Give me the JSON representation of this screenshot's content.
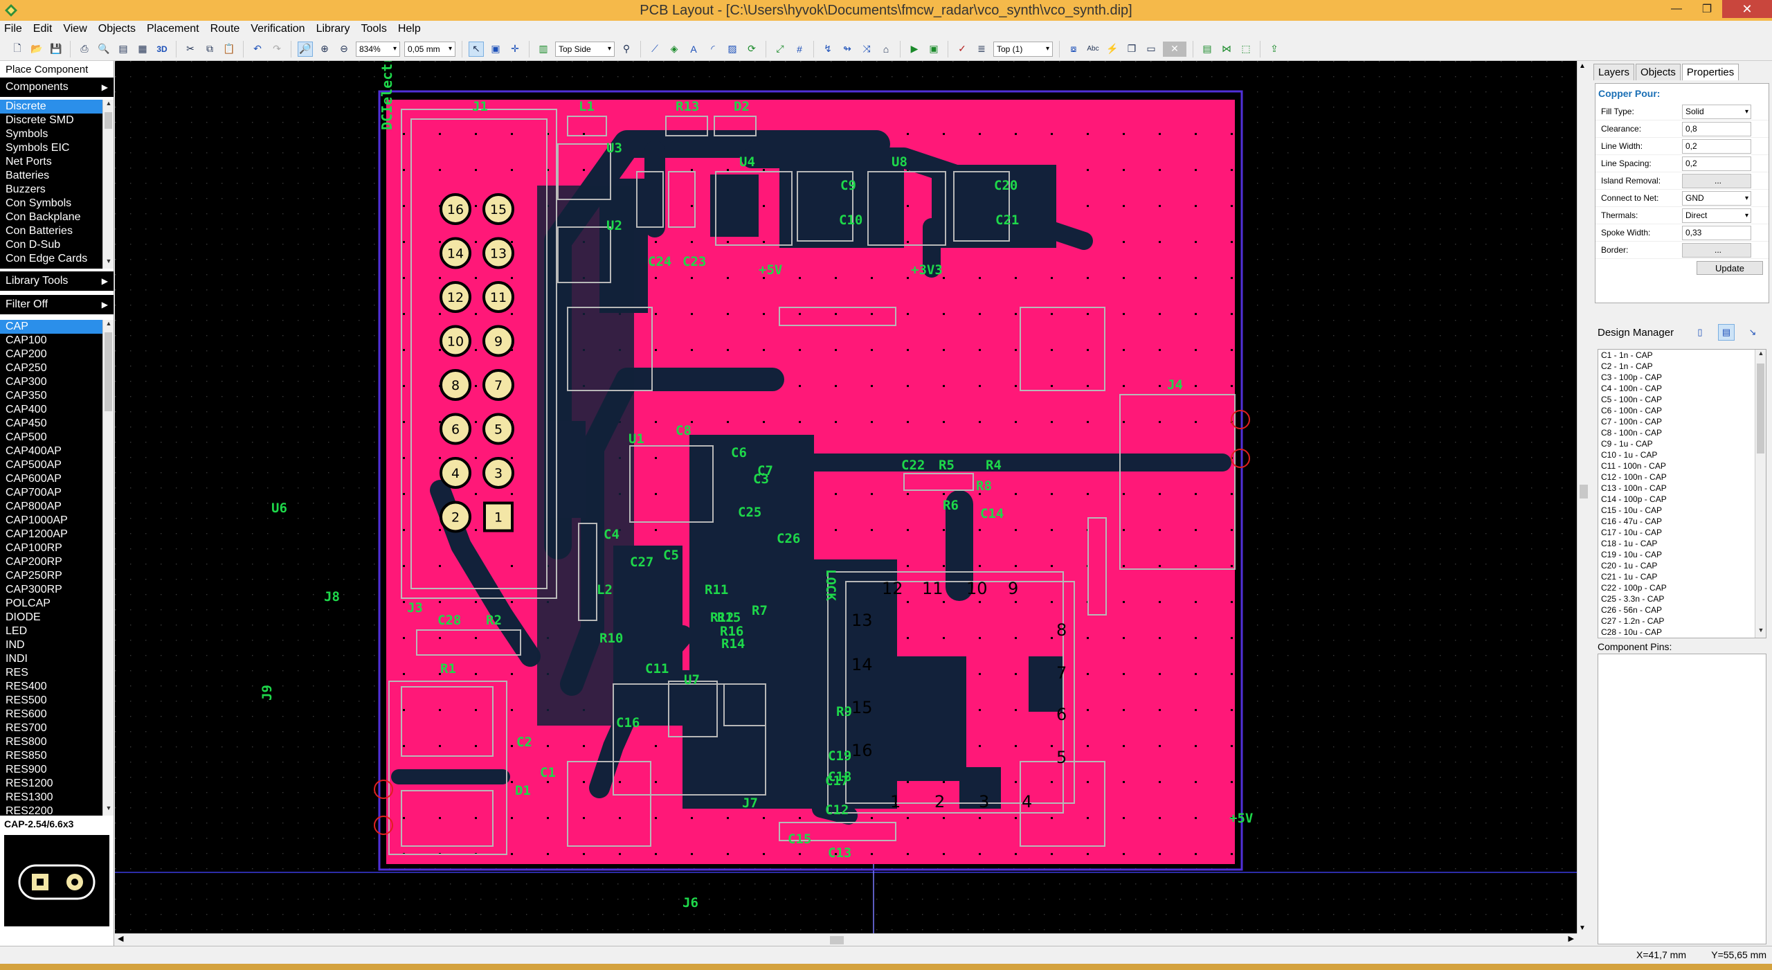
{
  "window": {
    "title": "PCB Layout - [C:\\Users\\hyvok\\Documents\\fmcw_radar\\vco_synth\\vco_synth.dip]"
  },
  "menu": [
    "File",
    "Edit",
    "View",
    "Objects",
    "Placement",
    "Route",
    "Verification",
    "Library",
    "Tools",
    "Help"
  ],
  "toolbar": {
    "zoom": "834%",
    "grid": "0,05 mm",
    "side": "Top Side",
    "layer": "Top (1)"
  },
  "left": {
    "place_component": "Place Component",
    "components": "Components",
    "categories": [
      "Discrete",
      "Discrete SMD",
      "Symbols",
      "Symbols EIC",
      "Net Ports",
      "Batteries",
      "Buzzers",
      "Con Symbols",
      "Con Backplane",
      "Con Batteries",
      "Con D-Sub",
      "Con Edge Cards"
    ],
    "library_tools": "Library Tools",
    "filter": "Filter Off",
    "parts": [
      "CAP",
      "CAP100",
      "CAP200",
      "CAP250",
      "CAP300",
      "CAP350",
      "CAP400",
      "CAP450",
      "CAP500",
      "CAP400AP",
      "CAP500AP",
      "CAP600AP",
      "CAP700AP",
      "CAP800AP",
      "CAP1000AP",
      "CAP1200AP",
      "CAP100RP",
      "CAP200RP",
      "CAP250RP",
      "CAP300RP",
      "POLCAP",
      "DIODE",
      "LED",
      "IND",
      "INDI",
      "RES",
      "RES400",
      "RES500",
      "RES600",
      "RES700",
      "RES800",
      "RES850",
      "RES900",
      "RES1200",
      "RES1300",
      "RES2200"
    ],
    "footprint_name": "CAP-2.54/6.6x3"
  },
  "right": {
    "tabs": [
      "Layers",
      "Objects",
      "Properties"
    ],
    "copper_pour_title": "Copper Pour:",
    "props": [
      {
        "k": "Fill Type:",
        "v": "Solid",
        "t": "dd"
      },
      {
        "k": "Clearance:",
        "v": "0,8",
        "t": "txt"
      },
      {
        "k": "Line Width:",
        "v": "0,2",
        "t": "txt"
      },
      {
        "k": "Line Spacing:",
        "v": "0,2",
        "t": "txt"
      },
      {
        "k": "Island Removal:",
        "v": "...",
        "t": "btn"
      },
      {
        "k": "Connect to Net:",
        "v": "GND",
        "t": "dd"
      },
      {
        "k": "Thermals:",
        "v": "Direct",
        "t": "dd"
      },
      {
        "k": "Spoke Width:",
        "v": "0,33",
        "t": "txt"
      },
      {
        "k": "Border:",
        "v": "...",
        "t": "btn"
      }
    ],
    "update": "Update",
    "design_manager": "Design Manager",
    "components": [
      "C1 - 1n - CAP",
      "C2 - 1n - CAP",
      "C3 - 100p - CAP",
      "C4 - 100n - CAP",
      "C5 - 100n - CAP",
      "C6 - 100n - CAP",
      "C7 - 100n - CAP",
      "C8 - 100n - CAP",
      "C9 - 1u - CAP",
      "C10 - 1u - CAP",
      "C11 - 100n - CAP",
      "C12 - 100n - CAP",
      "C13 - 100n - CAP",
      "C14 - 100p - CAP",
      "C15 - 10u - CAP",
      "C16 - 47u - CAP",
      "C17 - 10u - CAP",
      "C18 - 1u - CAP",
      "C19 - 10u - CAP",
      "C20 - 1u - CAP",
      "C21 - 1u - CAP",
      "C22 - 100p - CAP",
      "C25 - 3.3n - CAP",
      "C26 - 56n - CAP",
      "C27 - 1.2n - CAP",
      "C28 - 10u - CAP"
    ],
    "component_pins": "Component Pins:"
  },
  "status": {
    "x": "X=41,7 mm",
    "y": "Y=55,65 mm"
  },
  "pcb": {
    "labels": [
      "J1",
      "L1",
      "R13",
      "D2",
      "U3",
      "U2",
      "C24",
      "C23",
      "U4",
      "C9",
      "C10",
      "U8",
      "C20",
      "C21",
      "+5V",
      "+3V3",
      "J4",
      "U1",
      "C8",
      "C6",
      "C3",
      "C7",
      "C4",
      "C25",
      "C26",
      "C22",
      "R5",
      "R4",
      "R6",
      "R8",
      "C14",
      "L2",
      "R10",
      "C27",
      "C5",
      "R11",
      "R12",
      "R14",
      "R9",
      "R7",
      "R16",
      "R15",
      "R2",
      "C2",
      "C1",
      "C11",
      "U7",
      "C16",
      "C17",
      "C15",
      "C13",
      "C12",
      "C18",
      "C19",
      "C28",
      "D1",
      "R1",
      "J3",
      "LOCK",
      "U6",
      "J8",
      "J9",
      "J6",
      "J7",
      "+5V",
      "DCIelectronics.com"
    ],
    "header_pins": [
      "16",
      "15",
      "14",
      "13",
      "12",
      "11",
      "10",
      "9",
      "8",
      "7",
      "6",
      "5",
      "4",
      "3",
      "2",
      "1"
    ],
    "u6_pins": [
      "12",
      "11",
      "10",
      "9",
      "13",
      "14",
      "15",
      "16",
      "8",
      "7",
      "6",
      "5",
      "1",
      "2",
      "3",
      "4"
    ]
  }
}
